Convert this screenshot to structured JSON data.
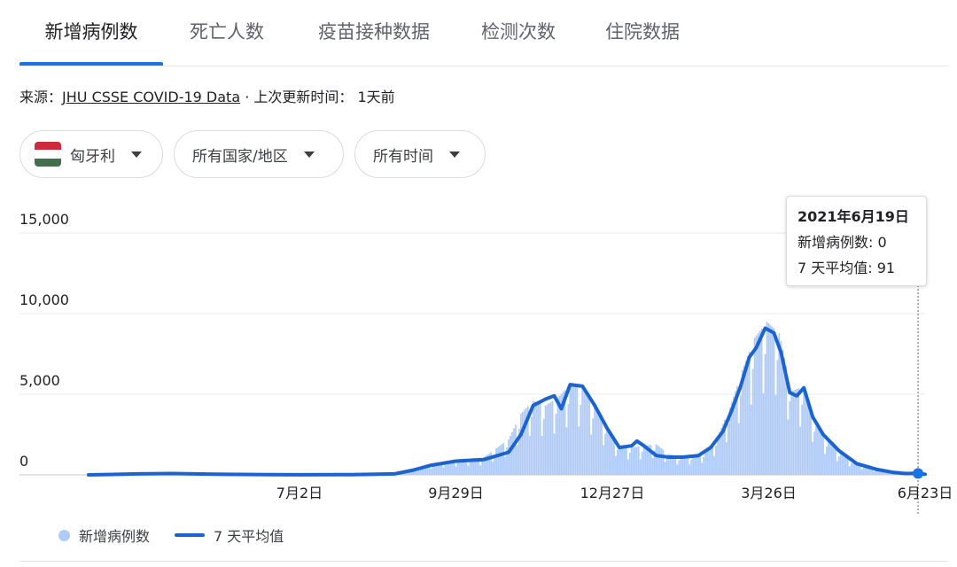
{
  "tabs": [
    {
      "label": "新增病例数",
      "active": true
    },
    {
      "label": "死亡人数",
      "active": false
    },
    {
      "label": "疫苗接种数据",
      "active": false
    },
    {
      "label": "检测次数",
      "active": false
    },
    {
      "label": "住院数据",
      "active": false
    }
  ],
  "source": {
    "prefix": "来源：",
    "link": "JHU CSSE COVID-19 Data",
    "suffix": " · 上次更新时间：  1天前"
  },
  "filters": {
    "country": "匈牙利",
    "region": "所有国家/地区",
    "time": "所有时间"
  },
  "flag_colors": [
    "#cd2a3e",
    "#ffffff",
    "#436f4d"
  ],
  "tooltip": {
    "date": "2021年6月19日",
    "cases_line": "新增病例数: 0",
    "avg_line": "7 天平均值: 91"
  },
  "legend": {
    "cases": "新增病例数",
    "avg": "7 天平均值"
  },
  "colors": {
    "accent": "#1a73e8",
    "bars": "#aecbfa",
    "line": "#1a63d1"
  },
  "chart_data": {
    "type": "bar+line",
    "ylim": [
      0,
      15000
    ],
    "yticks": [
      {
        "value": 0,
        "label": "0"
      },
      {
        "value": 5000,
        "label": "5,000"
      },
      {
        "value": 10000,
        "label": "10,000"
      },
      {
        "value": 15000,
        "label": "15,000"
      }
    ],
    "xticks": [
      {
        "date": "2020-07-02",
        "label": "7月2日"
      },
      {
        "date": "2020-09-29",
        "label": "9月29日"
      },
      {
        "date": "2020-12-27",
        "label": "12月27日"
      },
      {
        "date": "2021-03-26",
        "label": "3月26日"
      },
      {
        "date": "2021-06-23",
        "label": "6月23日"
      }
    ],
    "x_range": [
      "2020-03-04",
      "2021-06-23"
    ],
    "series": [
      {
        "name": "新增病例数",
        "kind": "bar",
        "points": [
          [
            "2020-03-04",
            0
          ],
          [
            "2020-04-01",
            35
          ],
          [
            "2020-05-01",
            20
          ],
          [
            "2020-06-01",
            10
          ],
          [
            "2020-07-01",
            8
          ],
          [
            "2020-08-01",
            20
          ],
          [
            "2020-08-20",
            60
          ],
          [
            "2020-09-01",
            300
          ],
          [
            "2020-09-15",
            700
          ],
          [
            "2020-09-29",
            950
          ],
          [
            "2020-10-15",
            1100
          ],
          [
            "2020-10-29",
            2200
          ],
          [
            "2020-11-05",
            3800
          ],
          [
            "2020-11-12",
            4600
          ],
          [
            "2020-11-19",
            4300
          ],
          [
            "2020-11-26",
            4800
          ],
          [
            "2020-12-03",
            5600
          ],
          [
            "2020-12-10",
            5400
          ],
          [
            "2020-12-17",
            4200
          ],
          [
            "2020-12-24",
            3000
          ],
          [
            "2020-12-31",
            1800
          ],
          [
            "2021-01-07",
            1700
          ],
          [
            "2021-01-14",
            1800
          ],
          [
            "2021-01-21",
            1900
          ],
          [
            "2021-01-28",
            1300
          ],
          [
            "2021-02-04",
            1100
          ],
          [
            "2021-02-11",
            1200
          ],
          [
            "2021-02-18",
            1400
          ],
          [
            "2021-02-25",
            2400
          ],
          [
            "2021-03-04",
            4200
          ],
          [
            "2021-03-11",
            6500
          ],
          [
            "2021-03-18",
            8500
          ],
          [
            "2021-03-25",
            9500
          ],
          [
            "2021-04-01",
            8800
          ],
          [
            "2021-04-08",
            5200
          ],
          [
            "2021-04-15",
            5500
          ],
          [
            "2021-04-22",
            3000
          ],
          [
            "2021-05-01",
            1800
          ],
          [
            "2021-05-10",
            1000
          ],
          [
            "2021-05-20",
            500
          ],
          [
            "2021-06-01",
            200
          ],
          [
            "2021-06-10",
            80
          ],
          [
            "2021-06-19",
            0
          ],
          [
            "2021-06-23",
            60
          ]
        ]
      },
      {
        "name": "7 天平均值",
        "kind": "line",
        "points": [
          [
            "2020-03-04",
            0
          ],
          [
            "2020-04-01",
            60
          ],
          [
            "2020-04-20",
            80
          ],
          [
            "2020-05-15",
            40
          ],
          [
            "2020-06-15",
            10
          ],
          [
            "2020-07-02",
            5
          ],
          [
            "2020-08-01",
            15
          ],
          [
            "2020-08-25",
            60
          ],
          [
            "2020-09-05",
            300
          ],
          [
            "2020-09-15",
            600
          ],
          [
            "2020-09-29",
            850
          ],
          [
            "2020-10-15",
            950
          ],
          [
            "2020-10-29",
            1400
          ],
          [
            "2020-11-05",
            2500
          ],
          [
            "2020-11-12",
            4300
          ],
          [
            "2020-11-19",
            4700
          ],
          [
            "2020-11-24",
            4900
          ],
          [
            "2020-11-28",
            4100
          ],
          [
            "2020-12-03",
            5600
          ],
          [
            "2020-12-10",
            5500
          ],
          [
            "2020-12-17",
            4300
          ],
          [
            "2020-12-24",
            2900
          ],
          [
            "2020-12-31",
            1700
          ],
          [
            "2021-01-07",
            1800
          ],
          [
            "2021-01-10",
            2100
          ],
          [
            "2021-01-14",
            1800
          ],
          [
            "2021-01-21",
            1200
          ],
          [
            "2021-01-28",
            1100
          ],
          [
            "2021-02-05",
            1100
          ],
          [
            "2021-02-14",
            1200
          ],
          [
            "2021-02-21",
            1700
          ],
          [
            "2021-02-28",
            2700
          ],
          [
            "2021-03-05",
            4000
          ],
          [
            "2021-03-10",
            5500
          ],
          [
            "2021-03-15",
            7300
          ],
          [
            "2021-03-19",
            7900
          ],
          [
            "2021-03-24",
            9100
          ],
          [
            "2021-03-29",
            8800
          ],
          [
            "2021-04-02",
            7600
          ],
          [
            "2021-04-07",
            5100
          ],
          [
            "2021-04-11",
            4900
          ],
          [
            "2021-04-15",
            5400
          ],
          [
            "2021-04-20",
            3600
          ],
          [
            "2021-04-26",
            2500
          ],
          [
            "2021-05-05",
            1500
          ],
          [
            "2021-05-15",
            700
          ],
          [
            "2021-05-26",
            350
          ],
          [
            "2021-06-05",
            150
          ],
          [
            "2021-06-12",
            80
          ],
          [
            "2021-06-19",
            91
          ],
          [
            "2021-06-23",
            40
          ]
        ]
      }
    ],
    "highlight": {
      "date": "2021-06-19",
      "value": 91
    }
  }
}
